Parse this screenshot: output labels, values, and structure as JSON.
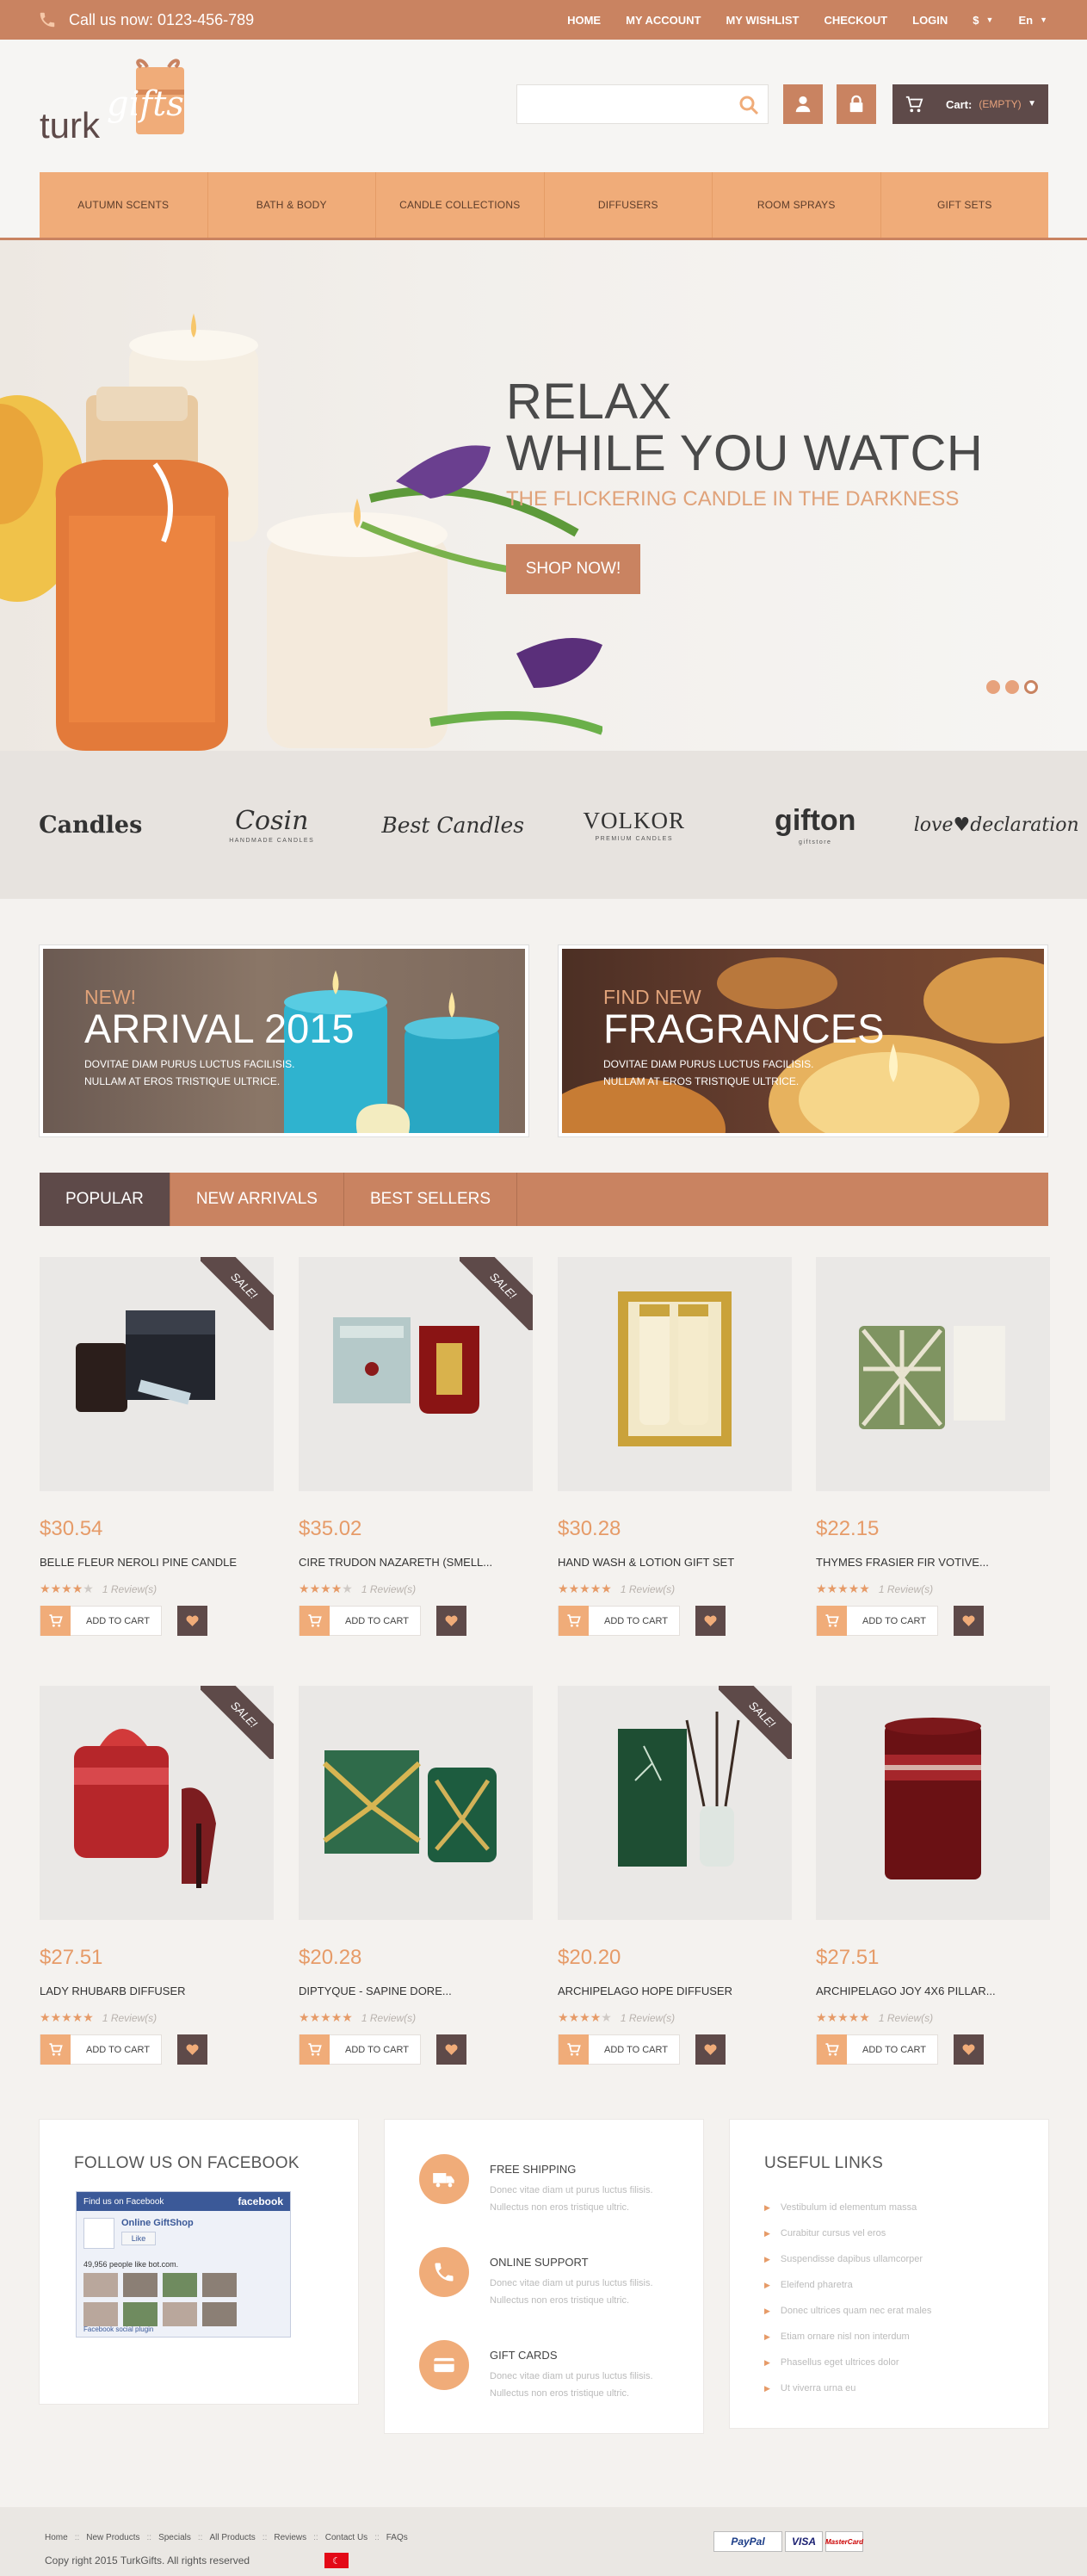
{
  "topbar": {
    "phone_label": "Call us now: 0123-456-789",
    "links": [
      "HOME",
      "MY ACCOUNT",
      "MY WISHLIST",
      "CHECKOUT",
      "LOGIN"
    ],
    "currency": "$",
    "language": "En"
  },
  "header": {
    "logo_text_1": "turk",
    "logo_text_2": "gifts",
    "search_placeholder": "",
    "cart_label": "Cart:",
    "cart_status": "(EMPTY)"
  },
  "nav": [
    "AUTUMN SCENTS",
    "BATH & BODY",
    "CANDLE COLLECTIONS",
    "DIFFUSERS",
    "ROOM SPRAYS",
    "GIFT SETS"
  ],
  "hero": {
    "line1": "RELAX",
    "line2": "WHILE YOU WATCH",
    "subtitle": "THE FLICKERING CANDLE IN THE DARKNESS",
    "button": "SHOP NOW!"
  },
  "brands": {
    "b1": "Candles",
    "b2": "Cosin",
    "b2_sub": "HANDMADE CANDLES",
    "b3": "Best Candles",
    "b4": "VOLKOR",
    "b4_sub": "PREMIUM CANDLES",
    "b5": "gifton",
    "b5_sub": "giftstore",
    "b6": "love♥declaration"
  },
  "banners": [
    {
      "label": "NEW!",
      "title": "ARRIVAL 2015",
      "text": "DOVITAE DIAM PURUS LUCTUS FACILISIS. NULLAM AT EROS TRISTIQUE ULTRICE."
    },
    {
      "label": "FIND NEW",
      "title": "FRAGRANCES",
      "text": "DOVITAE DIAM PURUS LUCTUS FACILISIS. NULLAM AT EROS TRISTIQUE ULTRICE."
    }
  ],
  "tabs": [
    "POPULAR",
    "NEW ARRIVALS",
    "BEST SELLERS"
  ],
  "sale_label": "SALE!",
  "add_to_cart": "ADD TO CART",
  "products": [
    {
      "price": "$30.54",
      "name": "BELLE FLEUR NEROLI PINE CANDLE",
      "reviews": "1 Review(s)",
      "stars": 4
    },
    {
      "price": "$35.02",
      "name": "CIRE TRUDON NAZARETH (SMELL...",
      "reviews": "1 Review(s)",
      "stars": 4
    },
    {
      "price": "$30.28",
      "name": "HAND WASH & LOTION GIFT SET",
      "reviews": "1 Review(s)",
      "stars": 5
    },
    {
      "price": "$22.15",
      "name": "THYMES FRASIER FIR VOTIVE...",
      "reviews": "1 Review(s)",
      "stars": 5
    },
    {
      "price": "$27.51",
      "name": "LADY RHUBARB DIFFUSER",
      "reviews": "1 Review(s)",
      "stars": 5
    },
    {
      "price": "$20.28",
      "name": "DIPTYQUE - SAPINE DORE...",
      "reviews": "1 Review(s)",
      "stars": 5
    },
    {
      "price": "$20.20",
      "name": "ARCHIPELAGO HOPE DIFFUSER",
      "reviews": "1 Review(s)",
      "stars": 4
    },
    {
      "price": "$27.51",
      "name": "ARCHIPELAGO JOY 4X6 PILLAR...",
      "reviews": "1 Review(s)",
      "stars": 5
    }
  ],
  "facebook": {
    "title": "FOLLOW US ON FACEBOOK",
    "bar_left": "Find us on Facebook",
    "bar_right": "facebook",
    "page_name": "Online GiftShop",
    "like": "Like",
    "count": "49,956 people like bot.com.",
    "plugin": "Facebook social plugin"
  },
  "services": [
    {
      "title": "FREE SHIPPING",
      "text": "Donec vitae diam ut purus luctus filisis. Nullectus non eros tristique ultric."
    },
    {
      "title": "ONLINE SUPPORT",
      "text": "Donec vitae diam ut purus luctus filisis. Nullectus non eros tristique ultric."
    },
    {
      "title": "GIFT CARDS",
      "text": "Donec vitae diam ut purus luctus filisis. Nullectus non eros tristique ultric."
    }
  ],
  "useful": {
    "title": "USEFUL LINKS",
    "links": [
      "Vestibulum id elementum massa",
      "Curabitur cursus vel eros",
      "Suspendisse dapibus ullamcorper",
      "Eleifend pharetra",
      "Donec ultrices quam nec erat males",
      "Etiam ornare nisl non interdum",
      "Phasellus eget ultrices dolor",
      "Ut viverra urna eu"
    ]
  },
  "bottom": {
    "links": [
      "Home",
      "New Products",
      "Specials",
      "All Products",
      "Reviews",
      "Contact Us",
      "FAQs"
    ],
    "copyright": "Copy right 2015 TurkGifts. All rights reserved",
    "pay": [
      "PayPal",
      "VISA",
      "MasterCard"
    ]
  },
  "colors": {
    "accent": "#c98361",
    "nav": "#f0ac79",
    "dark": "#5e4a49",
    "price": "#e69b68"
  }
}
